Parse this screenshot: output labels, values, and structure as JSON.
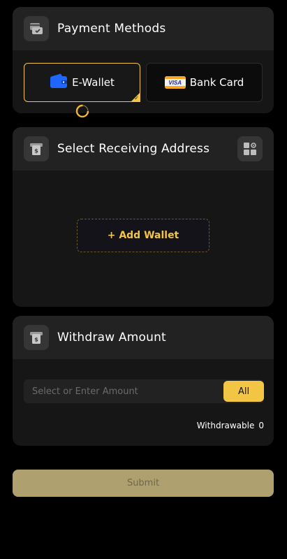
{
  "payment": {
    "title": "Payment Methods",
    "icon": "payment-card-icon",
    "methods": [
      {
        "label": "E-Wallet",
        "icon": "wallet-icon",
        "selected": true
      },
      {
        "label": "Bank Card",
        "icon": "visa-card-icon",
        "selected": false
      }
    ],
    "visa_text": "VISA"
  },
  "address": {
    "title": "Select Receiving Address",
    "icon": "atm-cash-icon",
    "right_icon": "grid-settings-icon",
    "add_wallet_label": "+ Add Wallet"
  },
  "withdraw": {
    "title": "Withdraw Amount",
    "icon": "atm-cash-icon",
    "amount_placeholder": "Select or Enter Amount",
    "all_label": "All",
    "withdrawable_label": "Withdrawable",
    "withdrawable_value": "0"
  },
  "submit_label": "Submit",
  "colors": {
    "accent": "#f3c545",
    "submit_bg": "#aea16f",
    "card_bg": "#161616",
    "header_bg": "#222222",
    "wallet_blue": "#1e66ff"
  }
}
